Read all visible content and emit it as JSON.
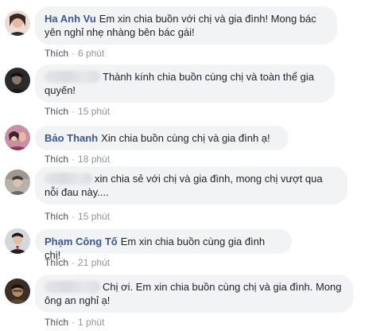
{
  "like_label": "Thích",
  "comments": [
    {
      "author": "Ha Anh Vu",
      "text": "Em xin chia buồn với chị và gia đình! Mong bác yên nghỉ nhẹ nhàng bên bác gái!",
      "time": "6 phút"
    },
    {
      "author": "",
      "text": "Thành kính chia buồn cùng chị và toàn thể gia quyến!",
      "time": "15 phút"
    },
    {
      "author": "Bảo Thanh",
      "text": "Xin chia buồn cùng chị và gia đình ạ!",
      "time": "18 phút"
    },
    {
      "author": "",
      "text": "xin chia sẻ với chị và gia đình, mong chị vượt qua nỗi đau này....",
      "time": "15 phút"
    },
    {
      "author": "Phạm Công Tố",
      "text": "Em xin chia buồn cùng gia đình chị!",
      "time": "21 phút"
    },
    {
      "author": "",
      "text": "Chị ơi. Em xin chia buồn cùng chị và gia đình. Mong ông an nghỉ ạ!",
      "time": "1 phút"
    }
  ]
}
